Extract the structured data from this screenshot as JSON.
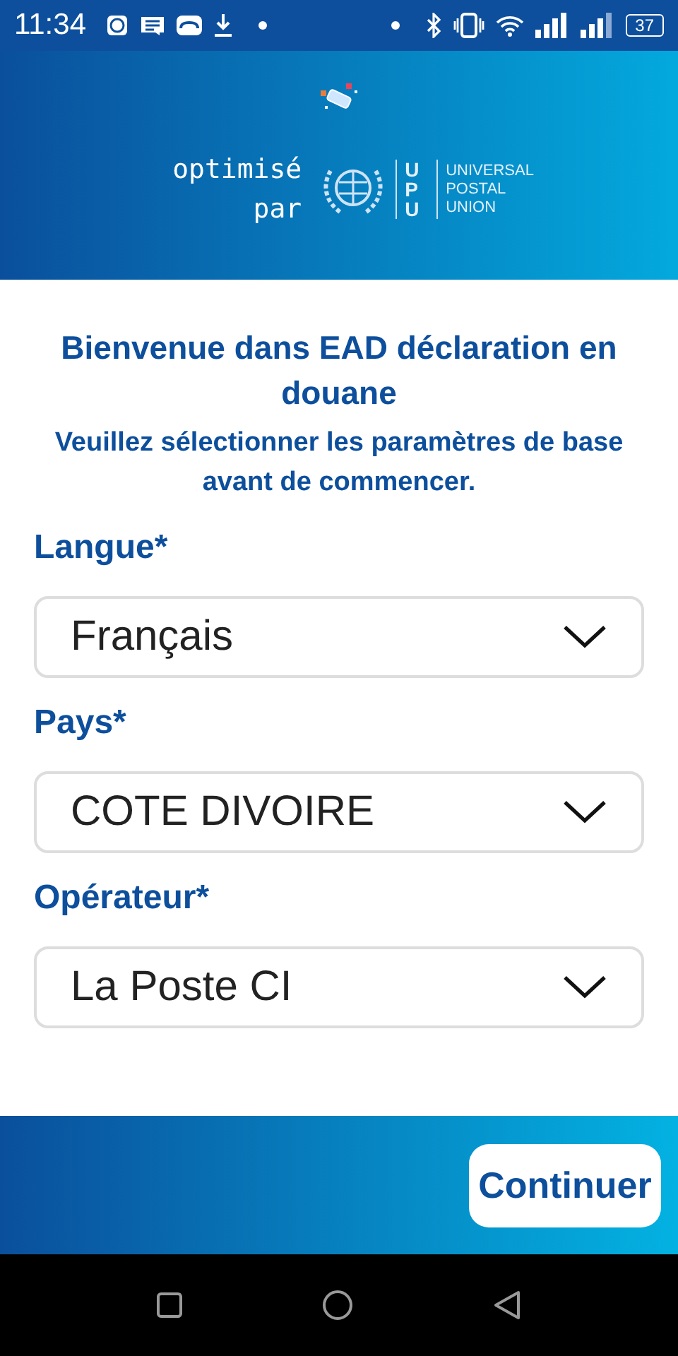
{
  "status_bar": {
    "time": "11:34",
    "battery": "37"
  },
  "header": {
    "tagline_line1": "optimisé",
    "tagline_line2": "par",
    "logo_mark": "UPU",
    "logo_words": [
      "UNIVERSAL",
      "POSTAL",
      "UNION"
    ]
  },
  "welcome": {
    "title": "Bienvenue dans EAD déclaration en douane",
    "subtitle": "Veuillez sélectionner les paramètres de base avant de commencer."
  },
  "fields": [
    {
      "label": "Langue*",
      "value": "Français"
    },
    {
      "label": "Pays*",
      "value": "COTE DIVOIRE"
    },
    {
      "label": "Opérateur*",
      "value": "La Poste CI"
    }
  ],
  "footer": {
    "button": "Continuer"
  }
}
